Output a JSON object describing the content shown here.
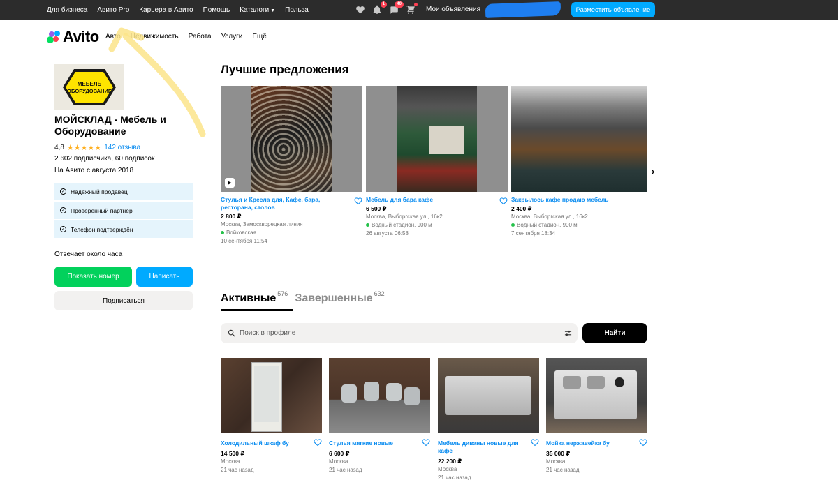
{
  "topbar": {
    "nav": [
      "Для бизнеса",
      "Авито Pro",
      "Карьера в Авито",
      "Помощь",
      "Каталоги",
      "Польза"
    ],
    "notifications_badge": "1",
    "messages_badge": "40",
    "my_ads": "Мои объявления",
    "post_button": "Разместить объявление"
  },
  "header": {
    "logo": "Avito",
    "nav": [
      "Авто",
      "Недвижимость",
      "Работа",
      "Услуги",
      "Ещё"
    ]
  },
  "profile": {
    "logo_text_line1": "МЕБЕЛЬ",
    "logo_text_line2": "ОБОРУДОВАНИЕ",
    "name": "МОЙСКЛАД - Мебель и Оборудование",
    "rating": "4,8",
    "stars": "★★★★★",
    "reviews": "142 отзыва",
    "subscribers": "2 602 подписчика, 60 подписок",
    "since": "На Авито с августа 2018",
    "badges": [
      "Надёжный продавец",
      "Проверенный партнёр",
      "Телефон подтверждён"
    ],
    "response": "Отвечает около часа",
    "show_phone": "Показать номер",
    "write": "Написать",
    "subscribe": "Подписаться"
  },
  "best": {
    "title": "Лучшие предложения",
    "items": [
      {
        "title": "Стулья и Кресла для, Кафе, бара, ресторана, столов",
        "price": "2 800 ₽",
        "address": "Москва, Замоскворецкая линия",
        "metro": "Войковская",
        "date": "10 сентября 11:54"
      },
      {
        "title": "Мебель для бара кафе",
        "price": "6 500 ₽",
        "address": "Москва, Выборгская ул., 16к2",
        "metro": "Водный стадион, 900 м",
        "date": "26 августа 06:58"
      },
      {
        "title": "Закрылось кафе продаю мебель",
        "price": "2 400 ₽",
        "address": "Москва, Выборгская ул., 16к2",
        "metro": "Водный стадион, 900 м",
        "date": "7 сентября 18:34"
      }
    ]
  },
  "tabs": [
    {
      "label": "Активные",
      "count": "576"
    },
    {
      "label": "Завершенные",
      "count": "632"
    }
  ],
  "search": {
    "placeholder": "Поиск в профиле",
    "button": "Найти"
  },
  "listings": [
    {
      "title": "Холодильный шкаф бу",
      "price": "14 500 ₽",
      "city": "Москва",
      "date": "21 час назад"
    },
    {
      "title": "Стулья мягкие новые",
      "price": "6 600 ₽",
      "city": "Москва",
      "date": "21 час назад"
    },
    {
      "title": "Мебель диваны новые для кафе",
      "price": "22 200 ₽",
      "city": "Москва",
      "date": "21 час назад"
    },
    {
      "title": "Мойка нержавейка бу",
      "price": "35 000 ₽",
      "city": "Москва",
      "date": "21 час назад"
    }
  ],
  "colors": {
    "accent": "#00aaff",
    "green": "#02d15c",
    "link": "#0a8cf0",
    "topbar": "#2c2c2c",
    "annotation": "#fbe48a"
  }
}
